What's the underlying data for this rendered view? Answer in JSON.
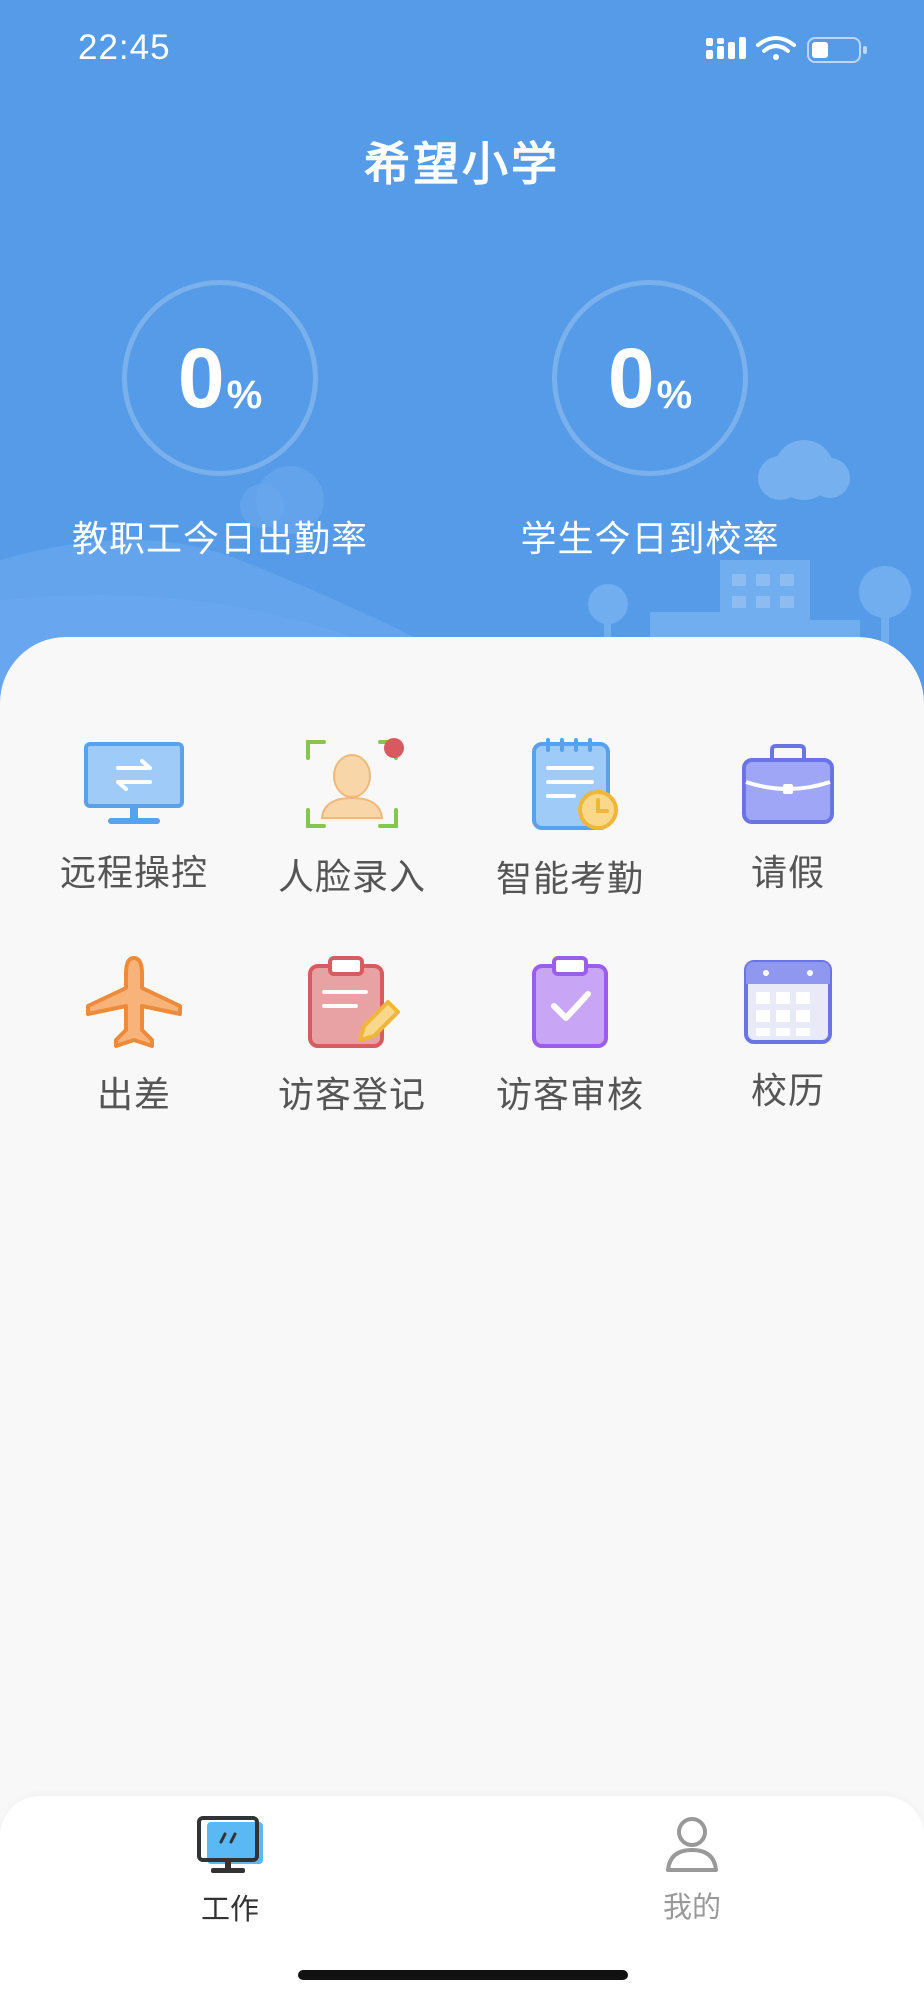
{
  "status_bar": {
    "time": "22:45"
  },
  "header": {
    "title": "希望小学",
    "stats": [
      {
        "value": "0",
        "unit": "%",
        "label": "教职工今日出勤率"
      },
      {
        "value": "0",
        "unit": "%",
        "label": "学生今日到校率"
      }
    ]
  },
  "apps": [
    {
      "label": "远程操控",
      "icon": "remote-control-icon"
    },
    {
      "label": "人脸录入",
      "icon": "face-enroll-icon"
    },
    {
      "label": "智能考勤",
      "icon": "attendance-icon"
    },
    {
      "label": "请假",
      "icon": "briefcase-icon"
    },
    {
      "label": "出差",
      "icon": "airplane-icon"
    },
    {
      "label": "访客登记",
      "icon": "visitor-register-icon"
    },
    {
      "label": "访客审核",
      "icon": "visitor-review-icon"
    },
    {
      "label": "校历",
      "icon": "calendar-icon"
    }
  ],
  "tabbar": {
    "tabs": [
      {
        "label": "工作",
        "icon": "monitor-icon",
        "active": true
      },
      {
        "label": "我的",
        "icon": "person-icon",
        "active": false
      }
    ]
  },
  "colors": {
    "header_blue": "#559be8",
    "active_tab": "#333333",
    "inactive_tab": "#999999"
  }
}
